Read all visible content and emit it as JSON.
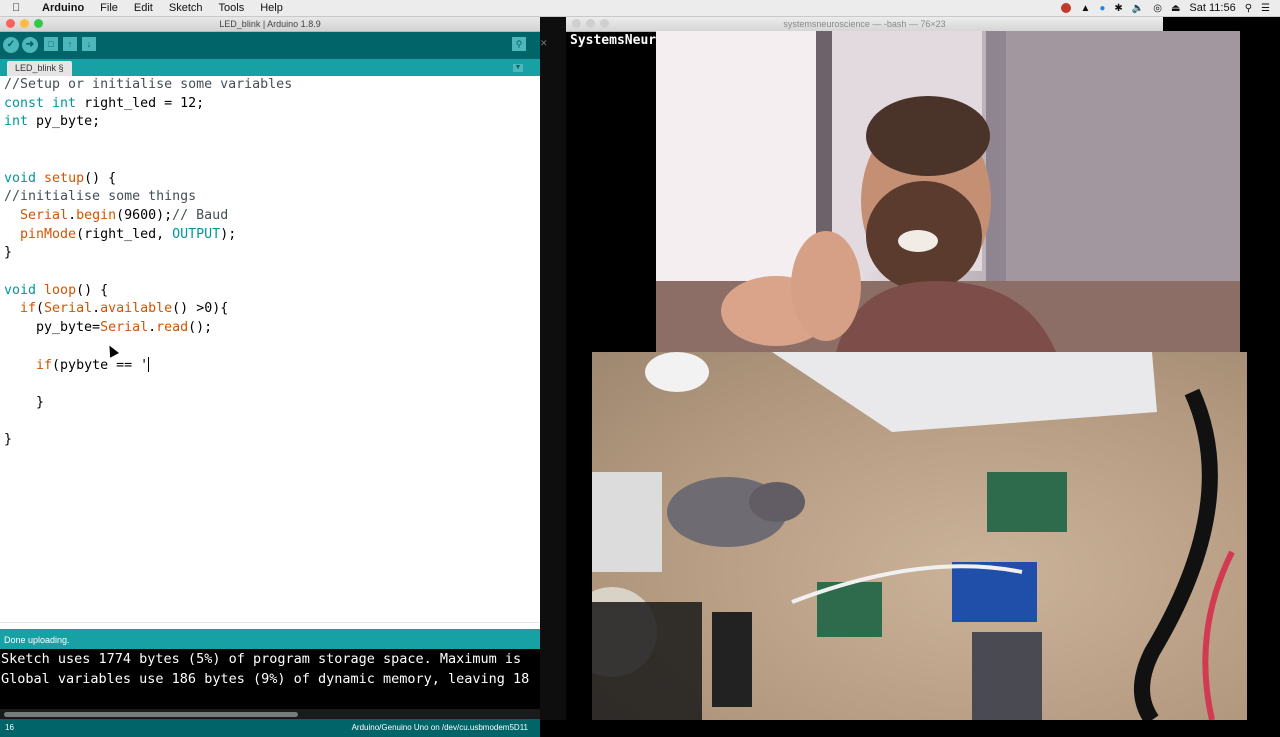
{
  "menubar": {
    "app": "Arduino",
    "items": [
      "File",
      "Edit",
      "Sketch",
      "Tools",
      "Help"
    ],
    "clock": "Sat 11:56"
  },
  "arduino": {
    "window_title": "LED_blink | Arduino 1.8.9",
    "tab": "LED_blink §",
    "code": [
      [
        {
          "t": "//Setup or initialise some variables",
          "c": "cm"
        }
      ],
      [
        {
          "t": "const int",
          "c": "kw"
        },
        {
          "t": " right_led = 12;",
          "c": ""
        }
      ],
      [
        {
          "t": "int",
          "c": "kw"
        },
        {
          "t": " py_byte;",
          "c": ""
        }
      ],
      [],
      [],
      [
        {
          "t": "void",
          "c": "kw"
        },
        {
          "t": " ",
          "c": ""
        },
        {
          "t": "setup",
          "c": "fn"
        },
        {
          "t": "() {",
          "c": ""
        }
      ],
      [
        {
          "t": "//initialise some things",
          "c": "cm"
        }
      ],
      [
        {
          "t": "  ",
          "c": ""
        },
        {
          "t": "Serial",
          "c": "fn"
        },
        {
          "t": ".",
          "c": ""
        },
        {
          "t": "begin",
          "c": "fn"
        },
        {
          "t": "(9600);",
          "c": ""
        },
        {
          "t": "// Baud",
          "c": "cm"
        }
      ],
      [
        {
          "t": "  ",
          "c": ""
        },
        {
          "t": "pinMode",
          "c": "fn"
        },
        {
          "t": "(right_led, ",
          "c": ""
        },
        {
          "t": "OUTPUT",
          "c": "kw"
        },
        {
          "t": ");",
          "c": ""
        }
      ],
      [
        {
          "t": "}",
          "c": ""
        }
      ],
      [],
      [
        {
          "t": "void",
          "c": "kw"
        },
        {
          "t": " ",
          "c": ""
        },
        {
          "t": "loop",
          "c": "fn"
        },
        {
          "t": "() {",
          "c": ""
        }
      ],
      [
        {
          "t": "  ",
          "c": ""
        },
        {
          "t": "if",
          "c": "fn"
        },
        {
          "t": "(",
          "c": ""
        },
        {
          "t": "Serial",
          "c": "fn"
        },
        {
          "t": ".",
          "c": ""
        },
        {
          "t": "available",
          "c": "fn"
        },
        {
          "t": "() >0){",
          "c": ""
        }
      ],
      [
        {
          "t": "    py_byte=",
          "c": ""
        },
        {
          "t": "Serial",
          "c": "fn"
        },
        {
          "t": ".",
          "c": ""
        },
        {
          "t": "read",
          "c": "fn"
        },
        {
          "t": "();",
          "c": ""
        }
      ],
      [],
      [
        {
          "t": "    ",
          "c": ""
        },
        {
          "t": "if",
          "c": "fn"
        },
        {
          "t": "(pybyte == '",
          "c": ""
        },
        {
          "t": "",
          "c": "cursor"
        }
      ],
      [],
      [
        {
          "t": "    }",
          "c": ""
        }
      ],
      [],
      [
        {
          "t": "}",
          "c": ""
        }
      ]
    ],
    "status": "Done uploading.",
    "console": [
      "Sketch uses 1774 bytes (5%) of program storage space. Maximum is",
      "Global variables use 186 bytes (9%) of dynamic memory, leaving 18"
    ],
    "line_number": "16",
    "board": "Arduino/Genuino Uno on /dev/cu.usbmodem5D11"
  },
  "terminal": {
    "title": "systemsneuroscience — -bash — 76×23",
    "text": "SystemsNeuro"
  },
  "colors": {
    "arduino_dark": "#006468",
    "arduino_teal": "#17a1a5",
    "keyword": "#00979c",
    "function": "#d35400"
  }
}
